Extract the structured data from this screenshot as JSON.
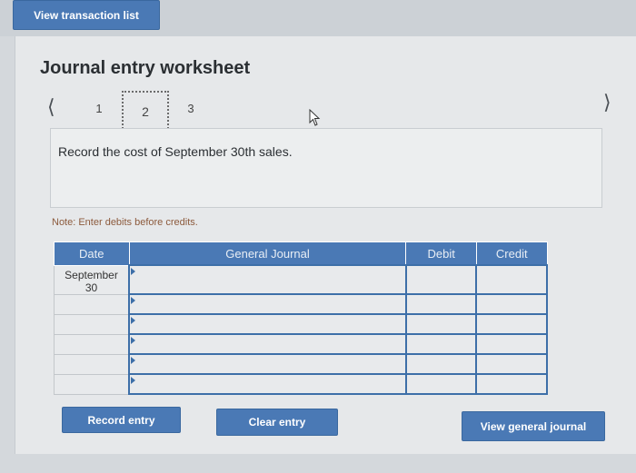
{
  "header": {
    "view_transaction_label": "View transaction list"
  },
  "worksheet": {
    "title": "Journal entry worksheet",
    "steps": [
      "1",
      "2",
      "3"
    ],
    "active_step": "2",
    "prompt": "Record the cost of September 30th sales.",
    "note": "Note: Enter debits before credits."
  },
  "table": {
    "columns": [
      "Date",
      "General Journal",
      "Debit",
      "Credit"
    ],
    "rows": [
      {
        "date": "September\n30",
        "general_journal": "",
        "debit": "",
        "credit": ""
      },
      {
        "date": "",
        "general_journal": "",
        "debit": "",
        "credit": ""
      },
      {
        "date": "",
        "general_journal": "",
        "debit": "",
        "credit": ""
      },
      {
        "date": "",
        "general_journal": "",
        "debit": "",
        "credit": ""
      },
      {
        "date": "",
        "general_journal": "",
        "debit": "",
        "credit": ""
      },
      {
        "date": "",
        "general_journal": "",
        "debit": "",
        "credit": ""
      }
    ]
  },
  "actions": {
    "record_label": "Record entry",
    "clear_label": "Clear entry",
    "view_general_label": "View general journal"
  },
  "icons": {
    "prev": "chevron-left-icon",
    "next": "chevron-right-icon",
    "cursor": "mouse-pointer-icon"
  },
  "colors": {
    "accent": "#4a79b5",
    "note": "#8c5a3c"
  }
}
